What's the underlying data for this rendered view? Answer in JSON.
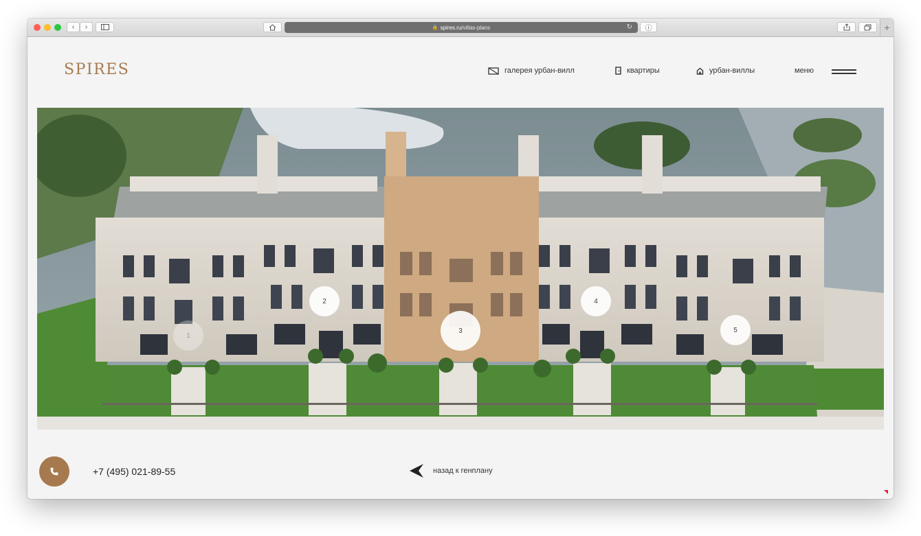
{
  "browser": {
    "url_host": "spires.ru",
    "url_path": "/villas-plans",
    "tab_add_label": "+"
  },
  "header": {
    "logo": "SPIRES",
    "nav": [
      {
        "label": "галерея урбан-вилл",
        "icon": "gallery-icon"
      },
      {
        "label": "квартиры",
        "icon": "door-icon"
      },
      {
        "label": "урбан-виллы",
        "icon": "house-icon"
      }
    ],
    "menu_label": "меню"
  },
  "villas": [
    "1",
    "2",
    "3",
    "4",
    "5"
  ],
  "footer": {
    "phone": "+7 (495) 021-89-55",
    "back_label": "назад к генплану"
  },
  "colors": {
    "brand": "#a67a4e",
    "page_bg": "#f4f4f4",
    "highlight": "#c8a27a"
  }
}
